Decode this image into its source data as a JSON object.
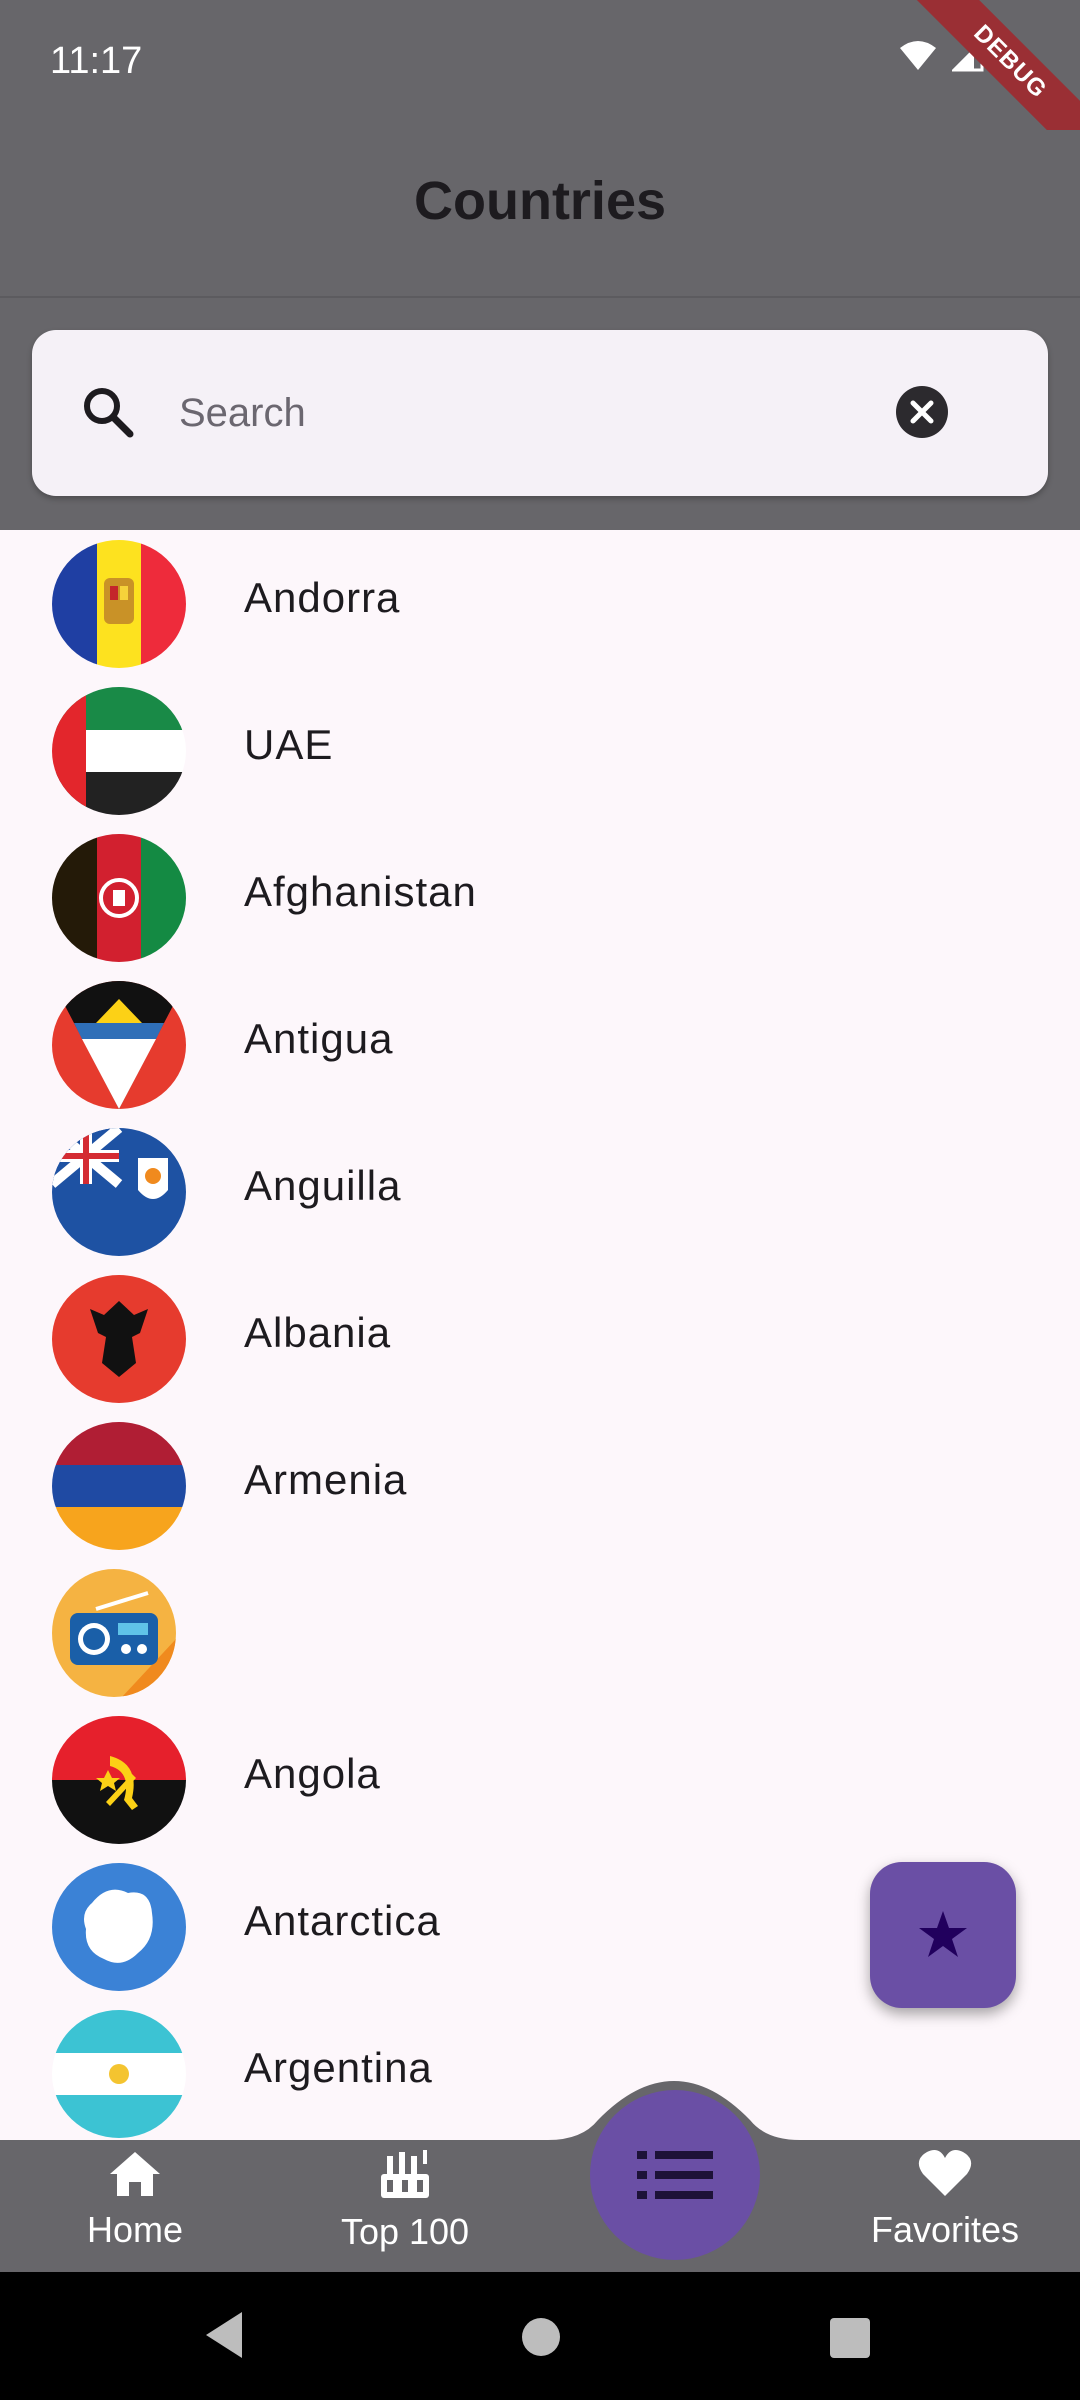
{
  "status_bar": {
    "time": "11:17"
  },
  "debug_banner": "DEBUG",
  "app_bar": {
    "title": "Countries"
  },
  "search": {
    "placeholder": "Search",
    "value": ""
  },
  "countries": [
    {
      "name": "Andorra",
      "flag": "andorra-flag"
    },
    {
      "name": "UAE",
      "flag": "uae-flag"
    },
    {
      "name": "Afghanistan",
      "flag": "afghanistan-flag"
    },
    {
      "name": "Antigua",
      "flag": "antigua-flag"
    },
    {
      "name": "Anguilla",
      "flag": "anguilla-flag"
    },
    {
      "name": "Albania",
      "flag": "albania-flag"
    },
    {
      "name": "Armenia",
      "flag": "armenia-flag"
    },
    {
      "name": "",
      "flag": "radio-placeholder"
    },
    {
      "name": "Angola",
      "flag": "angola-flag"
    },
    {
      "name": "Antarctica",
      "flag": "antarctica-flag"
    },
    {
      "name": "Argentina",
      "flag": "argentina-flag"
    }
  ],
  "bottom_nav": {
    "home_label": "Home",
    "top100_label": "Top 100",
    "favorites_label": "Favorites"
  },
  "colors": {
    "app_bar": "#67666a",
    "accent": "#6a4fa5",
    "background": "#fdf7fb"
  }
}
